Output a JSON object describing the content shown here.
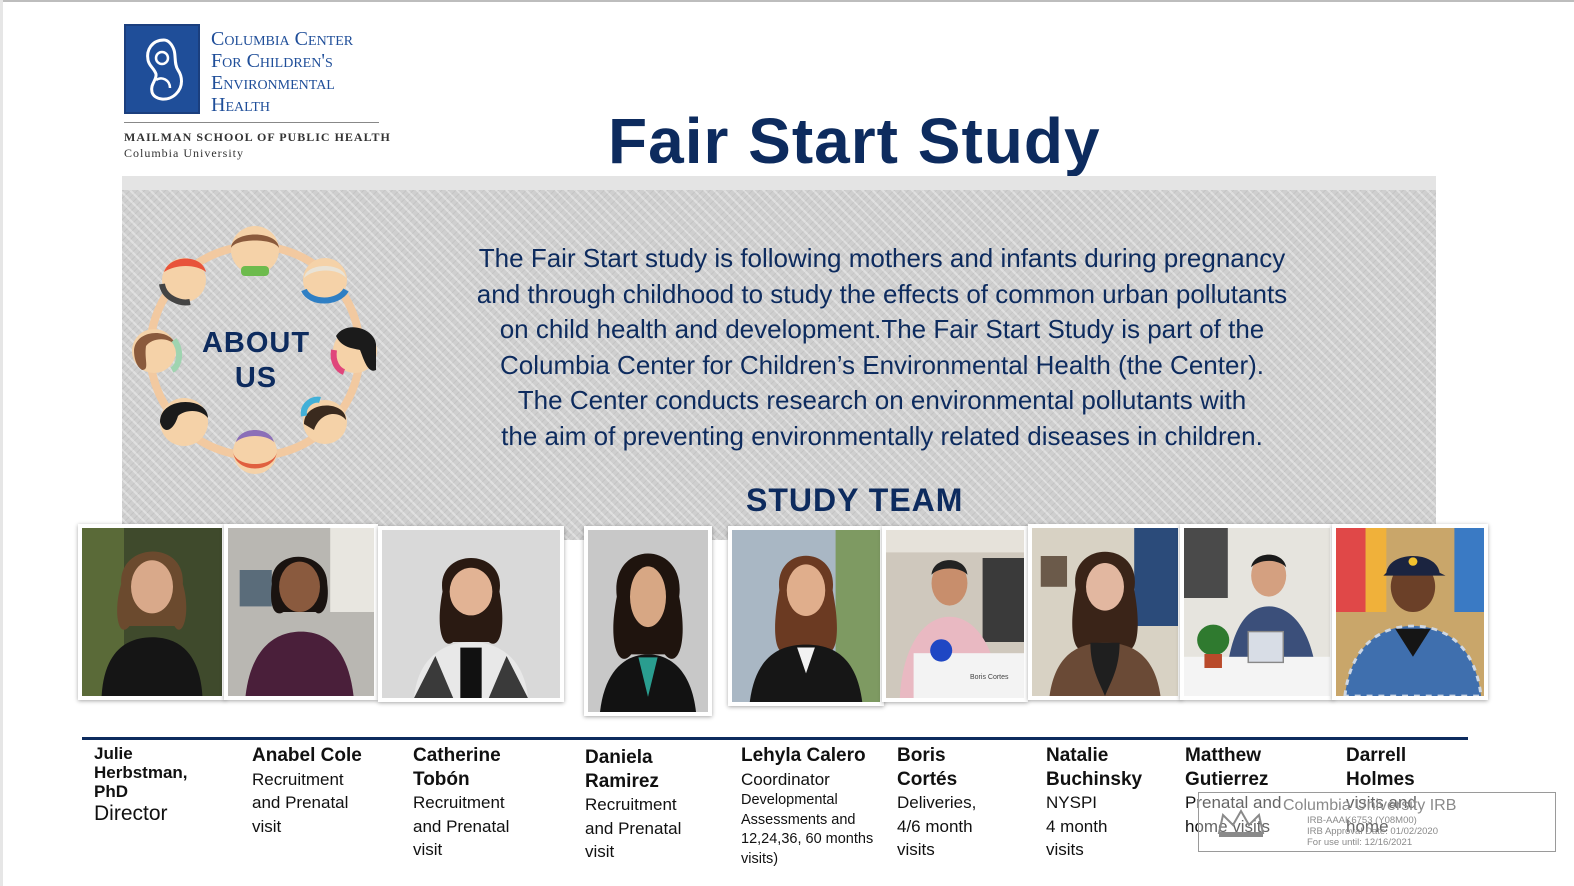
{
  "logo": {
    "line1": "Columbia Center",
    "line2": "For Children's",
    "line3": "Environmental",
    "line4": "Health",
    "school": "MAILMAN SCHOOL OF PUBLIC HEALTH",
    "university": "Columbia University"
  },
  "title": "Fair Start Study",
  "about": {
    "line1": "ABOUT",
    "line2": "US"
  },
  "description": [
    "The Fair Start study is following mothers and infants during pregnancy",
    "and through childhood to study the effects of common urban pollutants",
    "on child health and development.The Fair Start Study is part of the",
    "Columbia Center for Children’s Environmental Health (the Center).",
    "The Center conducts research on environmental pollutants with",
    "the aim of preventing environmentally related diseases in children."
  ],
  "study_team_title": "STUDY TEAM",
  "team": [
    {
      "name1": "Julie",
      "name2": "Herbstman,",
      "name3": "PhD",
      "role1": "Director"
    },
    {
      "name1": "Anabel Cole",
      "role1": "Recruitment",
      "role2": "and Prenatal",
      "role3": "visit"
    },
    {
      "name1": "Catherine",
      "name2": "Tobón",
      "role1": "Recruitment",
      "role2": "and Prenatal",
      "role3": "visit"
    },
    {
      "name1": "Daniela",
      "name2": "Ramirez",
      "role1": "Recruitment",
      "role2": "and Prenatal",
      "role3": "visit"
    },
    {
      "name1": "Lehyla Calero",
      "role1": "Coordinator",
      "role2": "Developmental",
      "role3": "Assessments and",
      "role4": "12,24,36, 60 months",
      "role5": "visits)"
    },
    {
      "name1": "Boris",
      "name2": "Cortés",
      "role1": "Deliveries,",
      "role2": "4/6 month",
      "role3": "visits"
    },
    {
      "name1": "Natalie",
      "name2": "Buchinsky",
      "role1": "NYSPI",
      "role2": "4 month",
      "role3": "visits"
    },
    {
      "name1": "Matthew",
      "name2": "Gutierrez",
      "role1": "Prenatal and",
      "role2": "home visits"
    },
    {
      "name1": "Darrell",
      "name2": "Holmes",
      "role1": "visits and",
      "role2": "home"
    }
  ],
  "photo_label": "Boris Cortes",
  "irb": {
    "name": "Columbia University IRB",
    "protocol": "IRB-AAAK6753 (Y08M00)",
    "approval": "IRB Approval Date: 01/02/2020",
    "use_until": "For use until: 12/16/2021"
  },
  "colors": {
    "navy": "#0d2b5e",
    "logo_blue": "#1f4e99",
    "panel_grey": "#cfcfcf"
  }
}
